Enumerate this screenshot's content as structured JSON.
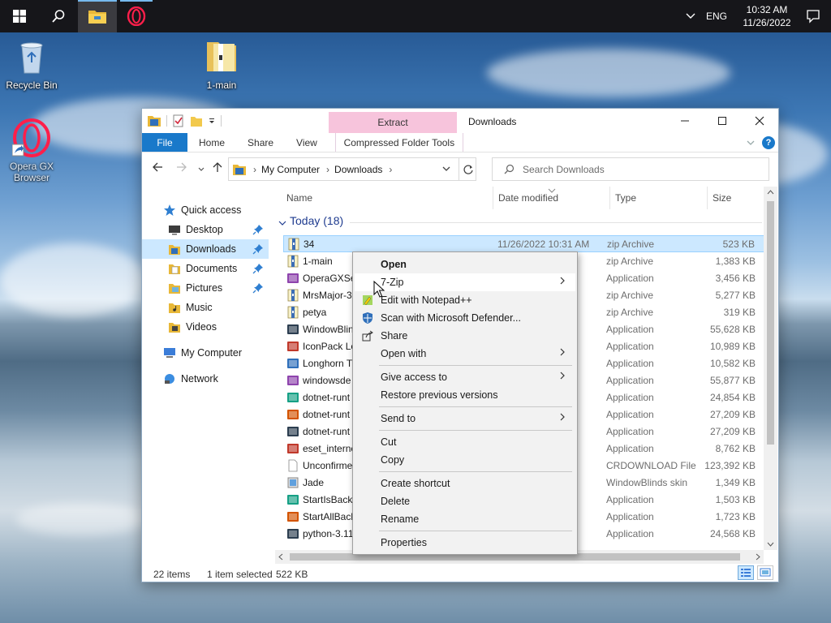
{
  "taskbar": {
    "language": "ENG",
    "time": "10:32 AM",
    "date": "11/26/2022"
  },
  "desktop": {
    "icons": [
      {
        "label": "Recycle Bin"
      },
      {
        "label": "1-main"
      },
      {
        "label": "Opera GX Browser"
      }
    ]
  },
  "window": {
    "title": "Downloads",
    "contextual_tab_header": "Extract",
    "ribbon_tabs": [
      "File",
      "Home",
      "Share",
      "View",
      "Compressed Folder Tools"
    ],
    "address": {
      "crumbs": [
        "My Computer",
        "Downloads"
      ]
    },
    "search_placeholder": "Search Downloads",
    "nav": [
      {
        "label": "Quick access",
        "icon": "star-icon"
      },
      {
        "label": "Desktop",
        "icon": "desktop-icon",
        "pinned": true
      },
      {
        "label": "Downloads",
        "icon": "downloads-folder-icon",
        "pinned": true,
        "selected": true
      },
      {
        "label": "Documents",
        "icon": "documents-folder-icon",
        "pinned": true
      },
      {
        "label": "Pictures",
        "icon": "pictures-folder-icon",
        "pinned": true
      },
      {
        "label": "Music",
        "icon": "music-folder-icon"
      },
      {
        "label": "Videos",
        "icon": "videos-folder-icon"
      },
      {
        "label": "My Computer",
        "icon": "computer-icon"
      },
      {
        "label": "Network",
        "icon": "network-icon"
      }
    ],
    "columns": {
      "name": "Name",
      "date": "Date modified",
      "type": "Type",
      "size": "Size"
    },
    "group_header": "Today (18)",
    "files": [
      {
        "name": "34",
        "date": "11/26/2022 10:31 AM",
        "type": "zip Archive",
        "size": "523 KB",
        "selected": true
      },
      {
        "name": "1-main",
        "date": "M",
        "type": "zip Archive",
        "size": "1,383 KB"
      },
      {
        "name": "OperaGXSet",
        "date": "M",
        "type": "Application",
        "size": "3,456 KB"
      },
      {
        "name": "MrsMajor-3",
        "date": "M",
        "type": "zip Archive",
        "size": "5,277 KB"
      },
      {
        "name": "petya",
        "date": "M",
        "type": "zip Archive",
        "size": "319 KB"
      },
      {
        "name": "WindowBlin",
        "date": "M",
        "type": "Application",
        "size": "55,628 KB"
      },
      {
        "name": "IconPack Lo",
        "date": "M",
        "type": "Application",
        "size": "10,989 KB"
      },
      {
        "name": "Longhorn T",
        "date": "M",
        "type": "Application",
        "size": "10,582 KB"
      },
      {
        "name": "windowsde",
        "date": "M",
        "type": "Application",
        "size": "55,877 KB"
      },
      {
        "name": "dotnet-runt",
        "date": "M",
        "type": "Application",
        "size": "24,854 KB"
      },
      {
        "name": "dotnet-runt",
        "date": "M",
        "type": "Application",
        "size": "27,209 KB"
      },
      {
        "name": "dotnet-runt",
        "date": "M",
        "type": "Application",
        "size": "27,209 KB"
      },
      {
        "name": "eset_interne",
        "date": "M",
        "type": "Application",
        "size": "8,762 KB"
      },
      {
        "name": "Unconfirme",
        "date": "M",
        "type": "CRDOWNLOAD File",
        "size": "123,392 KB"
      },
      {
        "name": "Jade",
        "date": "M",
        "type": "WindowBlinds skin",
        "size": "1,349 KB"
      },
      {
        "name": "StartIsBackP",
        "date": "M",
        "type": "Application",
        "size": "1,503 KB"
      },
      {
        "name": "StartAllBack",
        "date": "M",
        "type": "Application",
        "size": "1,723 KB"
      },
      {
        "name": "python-3.11",
        "date": "M",
        "type": "Application",
        "size": "24,568 KB"
      }
    ],
    "status": {
      "items": "22 items",
      "selected": "1 item selected",
      "size": "522 KB"
    }
  },
  "context_menu": {
    "items": [
      {
        "label": "Open",
        "bold": true
      },
      {
        "label": "7-Zip",
        "submenu": true,
        "hover": true
      },
      {
        "label": "Edit with Notepad++",
        "icon": "notepadpp-icon"
      },
      {
        "label": "Scan with Microsoft Defender...",
        "icon": "defender-icon"
      },
      {
        "label": "Share",
        "icon": "share-icon"
      },
      {
        "label": "Open with",
        "submenu": true
      },
      {
        "label": "Give access to",
        "submenu": true
      },
      {
        "label": "Restore previous versions"
      },
      {
        "label": "Send to",
        "submenu": true
      },
      {
        "label": "Cut"
      },
      {
        "label": "Copy"
      },
      {
        "label": "Create shortcut"
      },
      {
        "label": "Delete"
      },
      {
        "label": "Rename"
      },
      {
        "label": "Properties"
      }
    ]
  },
  "colors": {
    "accent": "#1979ca",
    "selection": "#cce8ff",
    "contextual_tab": "#f7c4dc",
    "taskbar": "#16161a"
  }
}
